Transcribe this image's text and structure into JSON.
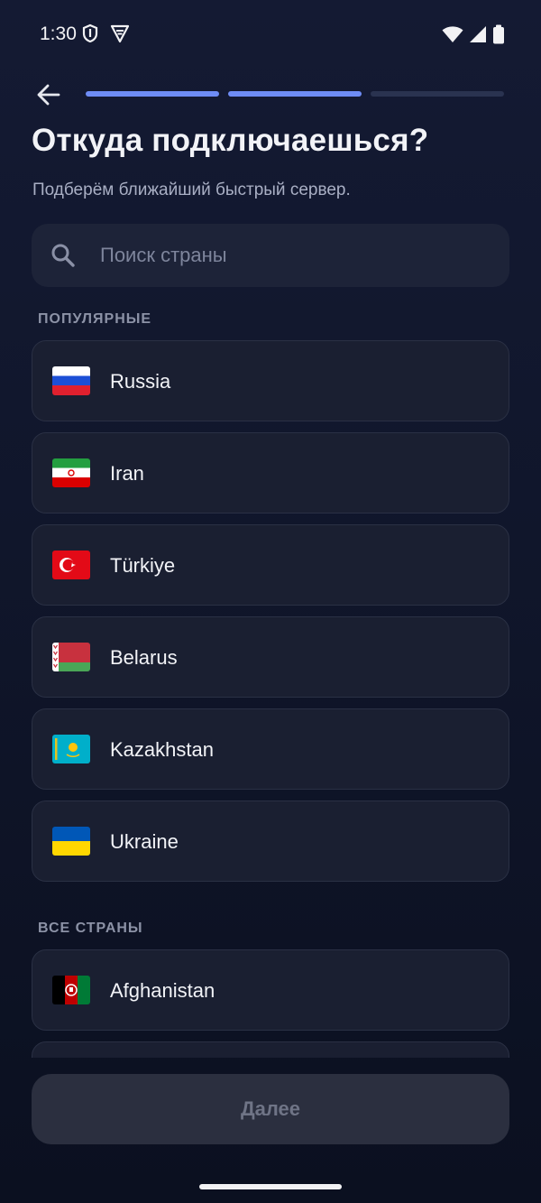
{
  "status_bar": {
    "time": "1:30"
  },
  "header": {
    "progress_steps": [
      {
        "state": "done"
      },
      {
        "state": "done"
      },
      {
        "state": "pending"
      }
    ],
    "title": "Откуда подключаешься?",
    "subtitle": "Подберём ближайший быстрый сервер."
  },
  "search": {
    "placeholder": "Поиск страны",
    "value": ""
  },
  "sections": {
    "popular_label": "ПОПУЛЯРНЫЕ",
    "all_label": "ВСЕ СТРАНЫ"
  },
  "popular_countries": [
    {
      "name": "Russia",
      "flag": "flag-russia"
    },
    {
      "name": "Iran",
      "flag": "flag-iran"
    },
    {
      "name": "Türkiye",
      "flag": "flag-turkiye"
    },
    {
      "name": "Belarus",
      "flag": "flag-belarus"
    },
    {
      "name": "Kazakhstan",
      "flag": "flag-kazakhstan"
    },
    {
      "name": "Ukraine",
      "flag": "flag-ukraine"
    }
  ],
  "all_countries": [
    {
      "name": "Afghanistan",
      "flag": "flag-afghanistan"
    }
  ],
  "footer": {
    "next_label": "Далее"
  },
  "colors": {
    "accent": "#6e8cf5",
    "background": "#141a33",
    "card": "#1a1f31",
    "button_disabled": "#2b2f3f"
  }
}
